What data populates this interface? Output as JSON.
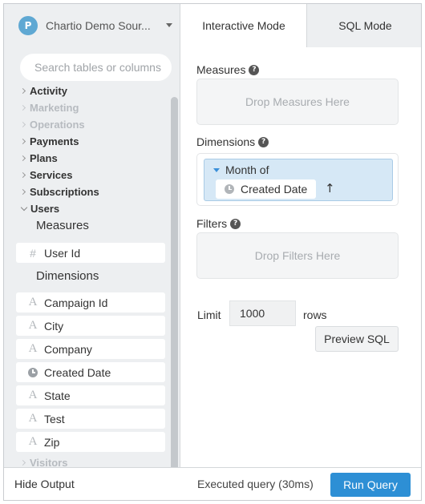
{
  "source": {
    "logo_letter": "P",
    "name": "Chartio Demo Sour..."
  },
  "search": {
    "placeholder": "Search tables or columns"
  },
  "tables": [
    {
      "name": "Activity",
      "state": "collapsed",
      "muted": false
    },
    {
      "name": "Marketing",
      "state": "collapsed",
      "muted": true
    },
    {
      "name": "Operations",
      "state": "collapsed",
      "muted": true
    },
    {
      "name": "Payments",
      "state": "collapsed",
      "muted": false
    },
    {
      "name": "Plans",
      "state": "collapsed",
      "muted": false
    },
    {
      "name": "Services",
      "state": "collapsed",
      "muted": false
    },
    {
      "name": "Subscriptions",
      "state": "collapsed",
      "muted": false
    },
    {
      "name": "Users",
      "state": "expanded",
      "muted": false
    },
    {
      "name": "Visitors",
      "state": "collapsed",
      "muted": true
    }
  ],
  "users_table": {
    "measures_heading": "Measures",
    "measures": [
      {
        "name": "User Id",
        "type_glyph": "#"
      }
    ],
    "dimensions_heading": "Dimensions",
    "dimensions": [
      {
        "name": "Campaign Id",
        "type_glyph": "A"
      },
      {
        "name": "City",
        "type_glyph": "A"
      },
      {
        "name": "Company",
        "type_glyph": "A"
      },
      {
        "name": "Created Date",
        "type_glyph": "clock-icon"
      },
      {
        "name": "State",
        "type_glyph": "A"
      },
      {
        "name": "Test",
        "type_glyph": "A"
      },
      {
        "name": "Zip",
        "type_glyph": "A"
      }
    ]
  },
  "tabs": [
    {
      "label": "Interactive Mode",
      "active": true
    },
    {
      "label": "SQL Mode",
      "active": false
    }
  ],
  "measures_panel": {
    "label": "Measures",
    "help": "?",
    "placeholder": "Drop Measures Here"
  },
  "dimensions_panel": {
    "label": "Dimensions",
    "help": "?",
    "pill": {
      "title": "Month of",
      "field": "Created Date",
      "sort_arrow": "↑"
    }
  },
  "filters_panel": {
    "label": "Filters",
    "help": "?",
    "placeholder": "Drop Filters Here"
  },
  "limit": {
    "label": "Limit",
    "value": "1000",
    "suffix": "rows"
  },
  "preview_label": "Preview SQL",
  "footer": {
    "hide_output": "Hide Output",
    "status": "Executed query (30ms)",
    "run_label": "Run Query"
  },
  "colors": {
    "run_button": "#2d8fd5",
    "pill_bg": "#d6e8f6",
    "sidebar_bg": "#edeff1"
  }
}
